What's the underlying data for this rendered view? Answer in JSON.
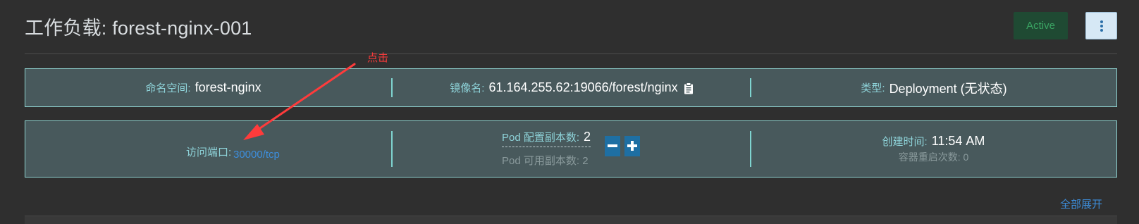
{
  "header": {
    "title": "工作负载: forest-nginx-001",
    "status": "Active",
    "menu_icon": "vertical-ellipsis-icon"
  },
  "summary": {
    "namespace_label": "命名空间:",
    "namespace_value": "forest-nginx",
    "image_label": "镜像名:",
    "image_value": "61.164.255.62:19066/forest/nginx",
    "copy_icon": "clipboard-icon",
    "type_label": "类型:",
    "type_value": "Deployment (无状态)"
  },
  "details": {
    "port_label": "访问端口:",
    "port_value": "30000/tcp",
    "replica_config_label": "Pod 配置副本数:",
    "replica_config_value": "2",
    "replica_available_text": "Pod 可用副本数: 2",
    "created_label": "创建时间:",
    "created_value": "11:54 AM",
    "restart_text": "容器重启次数: 0"
  },
  "annotation": {
    "text": "点击",
    "color": "#ff3b3b"
  },
  "expand_all_label": "全部展开",
  "colors": {
    "accent": "#3d8edc",
    "status_green": "#3aa463",
    "box_border": "#8fd3d0",
    "label": "#8ed3d9"
  }
}
